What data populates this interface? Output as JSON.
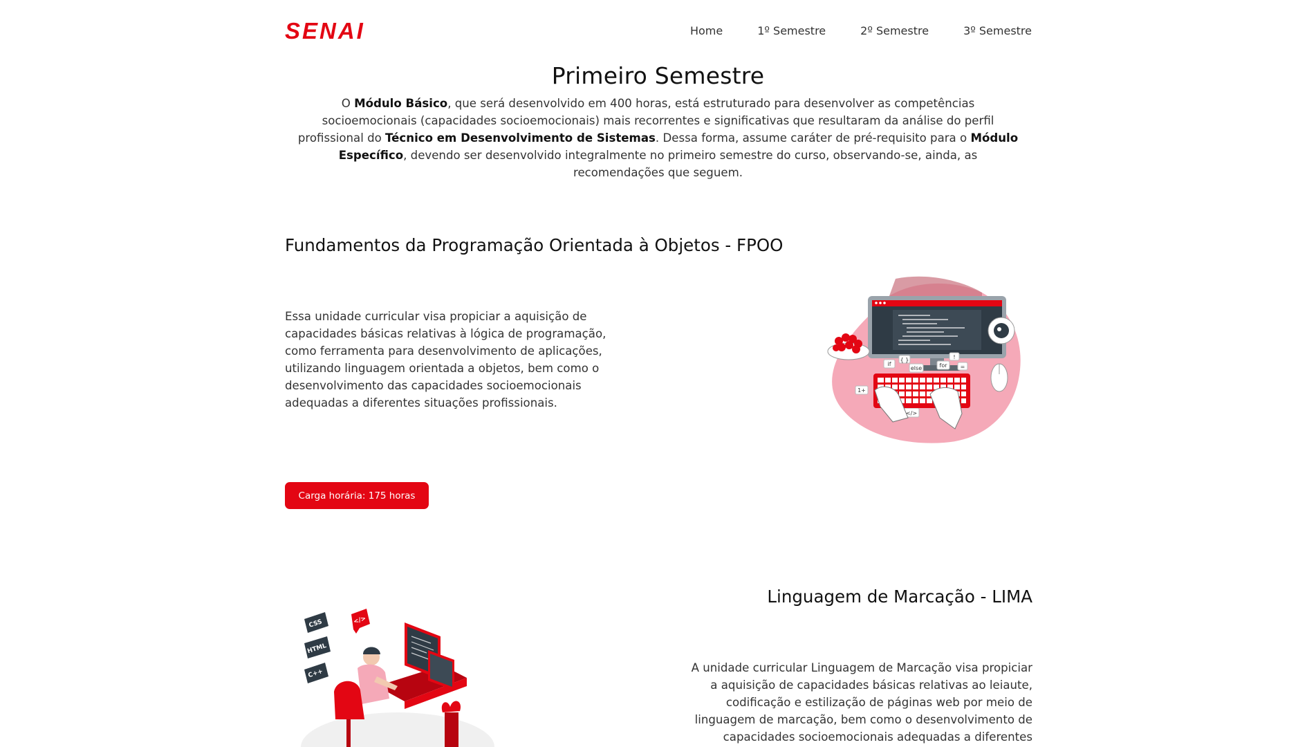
{
  "header": {
    "logo": "SENAI",
    "nav": [
      "Home",
      "1º Semestre",
      "2º Semestre",
      "3º Semestre"
    ]
  },
  "intro": {
    "title": "Primeiro Semestre",
    "p1": "O ",
    "b1": "Módulo Básico",
    "p2": ", que será desenvolvido em 400 horas, está estruturado para desenvolver as competências socioemocionais (capacidades socioemocionais) mais recorrentes e significativas que resultaram da análise do perfil profissional do ",
    "b2": "Técnico em Desenvolvimento de Sistemas",
    "p3": ". Dessa forma, assume caráter de pré-requisito para o ",
    "b3": "Módulo Específico",
    "p4": ", devendo ser desenvolvido integralmente no primeiro semestre do curso, observando-se, ainda, as recomendações que seguem."
  },
  "fpoo": {
    "title": "Fundamentos da Programação Orientada à Objetos - FPOO",
    "text": "Essa unidade curricular visa propiciar a aquisição de capacidades básicas relativas à lógica de programação, como ferramenta para desenvolvimento de aplicações, utilizando linguagem orientada a objetos, bem como o desenvolvimento das capacidades socioemocionais adequadas a diferentes situações profissionais.",
    "badge": "Carga horária: 175 horas",
    "illustration_labels": [
      "if",
      "else",
      "for",
      "{ }",
      "1+",
      "</>"
    ]
  },
  "lima": {
    "title": "Linguagem de Marcação - LIMA",
    "text": "A unidade curricular Linguagem de Marcação visa propiciar a aquisição de capacidades básicas relativas ao leiaute, codificação e estilização de páginas web por meio de linguagem de marcação, bem como o desenvolvimento de capacidades socioemocionais adequadas a diferentes situações profissionais.",
    "illustration_labels": [
      "CSS",
      "HTML",
      "C++",
      "</>"
    ]
  },
  "colors": {
    "brand": "#e30613",
    "pink": "#f5a9b8",
    "dark": "#2f3b45"
  }
}
